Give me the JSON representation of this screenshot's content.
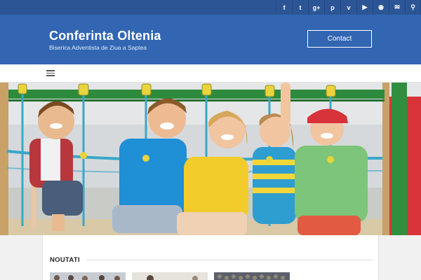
{
  "topbar": {
    "social_icons": [
      {
        "icon": "facebook-icon",
        "glyph": "f"
      },
      {
        "icon": "twitter-icon",
        "glyph": "t"
      },
      {
        "icon": "google-plus-icon",
        "glyph": "g+"
      },
      {
        "icon": "pinterest-icon",
        "glyph": "p"
      },
      {
        "icon": "vimeo-icon",
        "glyph": "v"
      },
      {
        "icon": "youtube-icon",
        "glyph": "▶"
      },
      {
        "icon": "rss-icon",
        "glyph": "◉"
      },
      {
        "icon": "mail-icon",
        "glyph": "✉"
      },
      {
        "icon": "search-icon",
        "glyph": "⚲"
      }
    ]
  },
  "header": {
    "title": "Conferinta Oltenia",
    "tagline": "Biserica Adventista de Ziua a Saptea",
    "contact_label": "Contact"
  },
  "nav": {
    "menu_icon": "hamburger-menu-icon"
  },
  "hero": {
    "image": "children-on-playground-rope-bridge"
  },
  "news": {
    "heading": "NOUTATI"
  },
  "colors": {
    "topbar": "#2c5596",
    "header": "#3266b3",
    "accent_green": "#2e8b3e"
  }
}
